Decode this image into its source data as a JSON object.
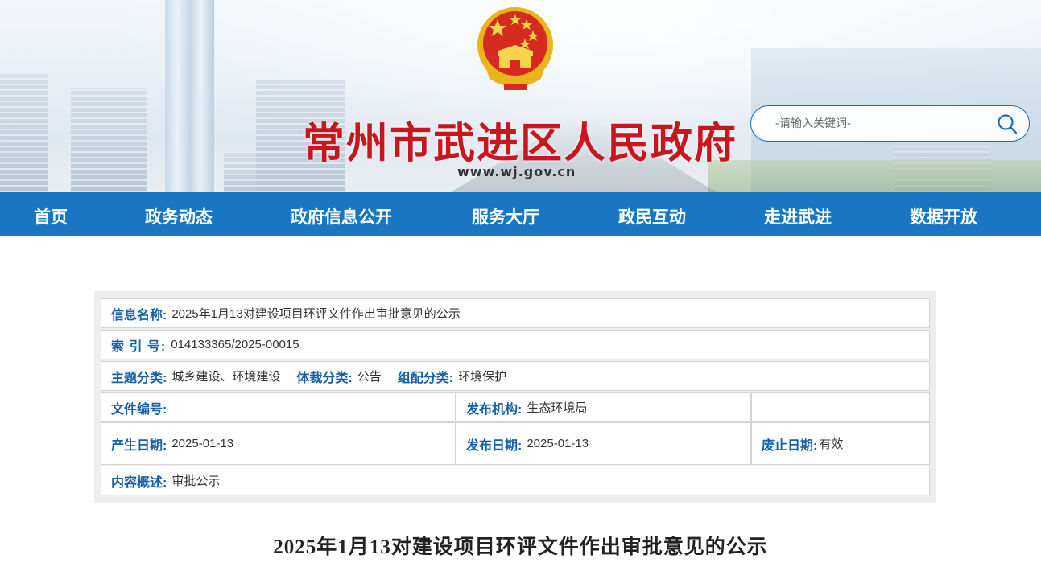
{
  "header": {
    "site_title": "常州市武进区人民政府",
    "site_url": "www.wj.gov.cn",
    "emblem": "national-emblem-icon"
  },
  "search": {
    "placeholder": "-请输入关键词-",
    "icon": "search-icon"
  },
  "nav": {
    "items": [
      "首页",
      "政务动态",
      "政府信息公开",
      "服务大厅",
      "政民互动",
      "走进武进",
      "数据开放"
    ]
  },
  "info": {
    "name_label": "信息名称:",
    "name_value": "2025年1月13对建设项目环评文件作出审批意见的公示",
    "index_label": "索 引 号:",
    "index_value": "014133365/2025-00015",
    "topic_label": "主题分类:",
    "topic_value": "城乡建设、环境建设",
    "genre_label": "体裁分类:",
    "genre_value": "公告",
    "org_class_label": "组配分类:",
    "org_class_value": "环境保护",
    "docno_label": "文件编号:",
    "docno_value": "",
    "publisher_label": "发布机构:",
    "publisher_value": "生态环境局",
    "created_label": "产生日期:",
    "created_value": "2025-01-13",
    "published_label": "发布日期:",
    "published_value": "2025-01-13",
    "expire_label": "废止日期:",
    "expire_value": "有效",
    "summary_label": "内容概述:",
    "summary_value": "审批公示"
  },
  "article": {
    "title": "2025年1月13对建设项目环评文件作出审批意见的公示"
  },
  "colors": {
    "nav_bg": "#1876c2",
    "title_red": "#c8161e",
    "label_blue": "#1560a8"
  }
}
